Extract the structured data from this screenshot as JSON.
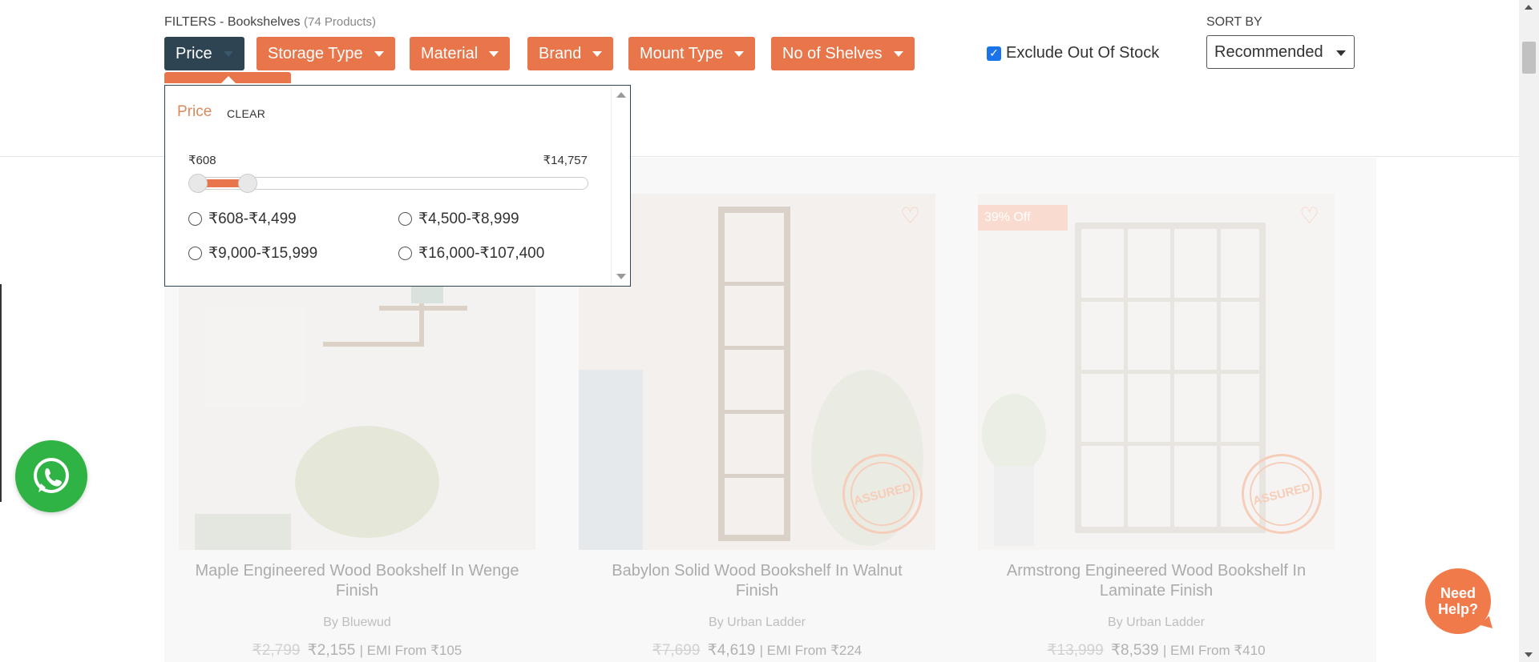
{
  "header": {
    "filters_label": "FILTERS - Bookshelves",
    "product_count": "(74 Products)",
    "chips": [
      {
        "label": "Price",
        "active": true
      },
      {
        "label": "Storage Type"
      },
      {
        "label": "Material"
      },
      {
        "label": "Brand"
      },
      {
        "label": "Mount Type"
      },
      {
        "label": "No of Shelves"
      }
    ],
    "exclude_label": "Exclude Out Of Stock",
    "exclude_checked": true,
    "sort_label": "SORT BY",
    "sort_value": "Recommended"
  },
  "price_panel": {
    "title": "Price",
    "clear": "CLEAR",
    "min_label": "₹608",
    "max_label": "₹14,757",
    "slider_low": 608,
    "slider_high": 4499,
    "options": [
      "₹608-₹4,499",
      "₹4,500-₹8,999",
      "₹9,000-₹15,999",
      "₹16,000-₹107,400"
    ]
  },
  "products": [
    {
      "name": "Maple Engineered Wood Bookshelf In Wenge Finish",
      "brand": "By Bluewud",
      "mrp": "₹2,799",
      "price": "₹2,155",
      "emi": "| EMI From ₹105",
      "discount": "",
      "assured": false
    },
    {
      "name": "Babylon Solid Wood Bookshelf In Walnut Finish",
      "brand": "By Urban Ladder",
      "mrp": "₹7,699",
      "price": "₹4,619",
      "emi": "| EMI From ₹224",
      "discount": "",
      "assured": true
    },
    {
      "name": "Armstrong Engineered Wood Bookshelf In Laminate Finish",
      "brand": "By Urban Ladder",
      "mrp": "₹13,999",
      "price": "₹8,539",
      "emi": "| EMI From ₹410",
      "discount": "39% Off",
      "assured": true
    }
  ],
  "assured_text": "ASSURED",
  "help_text": "Need Help?",
  "colors": {
    "accent": "#e9754a",
    "active_chip": "#2e4453",
    "whatsapp": "#2fb344"
  },
  "icons": [
    "heart-icon",
    "whatsapp-icon",
    "caret-down-icon"
  ]
}
